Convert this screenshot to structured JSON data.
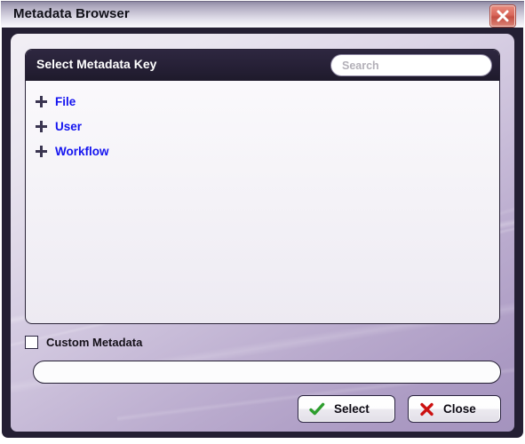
{
  "window": {
    "title": "Metadata Browser",
    "close_icon": "close-x-icon"
  },
  "panel": {
    "header_title": "Select Metadata Key",
    "search": {
      "value": "",
      "placeholder": "Search"
    },
    "tree_items": [
      {
        "label": "File",
        "expander": "plus-icon"
      },
      {
        "label": "User",
        "expander": "plus-icon"
      },
      {
        "label": "Workflow",
        "expander": "plus-icon"
      }
    ]
  },
  "custom": {
    "checkbox_label": "Custom Metadata",
    "checked": false,
    "input_value": "",
    "input_placeholder": ""
  },
  "footer": {
    "select_label": "Select",
    "select_icon": "green-check-icon",
    "close_label": "Close",
    "close_icon": "red-x-icon"
  },
  "colors": {
    "accent_purple": "#a493be",
    "header_dark": "#241f33",
    "link_blue": "#1414f0",
    "check_green": "#2e9e2e",
    "x_red": "#cc1111",
    "close_button_red": "#d9675a"
  }
}
